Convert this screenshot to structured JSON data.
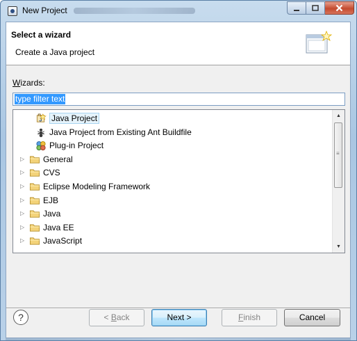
{
  "window": {
    "title": "New Project"
  },
  "banner": {
    "title": "Select a wizard",
    "description": "Create a Java project"
  },
  "wizards": {
    "label_mnemonic": "W",
    "label_rest": "izards:",
    "filter_value": "type filter text"
  },
  "tree": {
    "items": [
      {
        "label": "Java Project",
        "icon": "java-project-icon",
        "expandable": false,
        "selected": true
      },
      {
        "label": "Java Project from Existing Ant Buildfile",
        "icon": "ant-icon",
        "expandable": false
      },
      {
        "label": "Plug-in Project",
        "icon": "plugin-icon",
        "expandable": false
      },
      {
        "label": "General",
        "icon": "folder-icon",
        "expandable": true
      },
      {
        "label": "CVS",
        "icon": "folder-icon",
        "expandable": true
      },
      {
        "label": "Eclipse Modeling Framework",
        "icon": "folder-icon",
        "expandable": true
      },
      {
        "label": "EJB",
        "icon": "folder-icon",
        "expandable": true
      },
      {
        "label": "Java",
        "icon": "folder-icon",
        "expandable": true
      },
      {
        "label": "Java EE",
        "icon": "folder-icon",
        "expandable": true
      },
      {
        "label": "JavaScript",
        "icon": "folder-icon",
        "expandable": true
      }
    ]
  },
  "buttons": {
    "help": "?",
    "back_prefix": "< ",
    "back_mnemonic": "B",
    "back_rest": "ack",
    "next": "Next >",
    "finish_mnemonic": "F",
    "finish_rest": "inish",
    "cancel": "Cancel"
  }
}
